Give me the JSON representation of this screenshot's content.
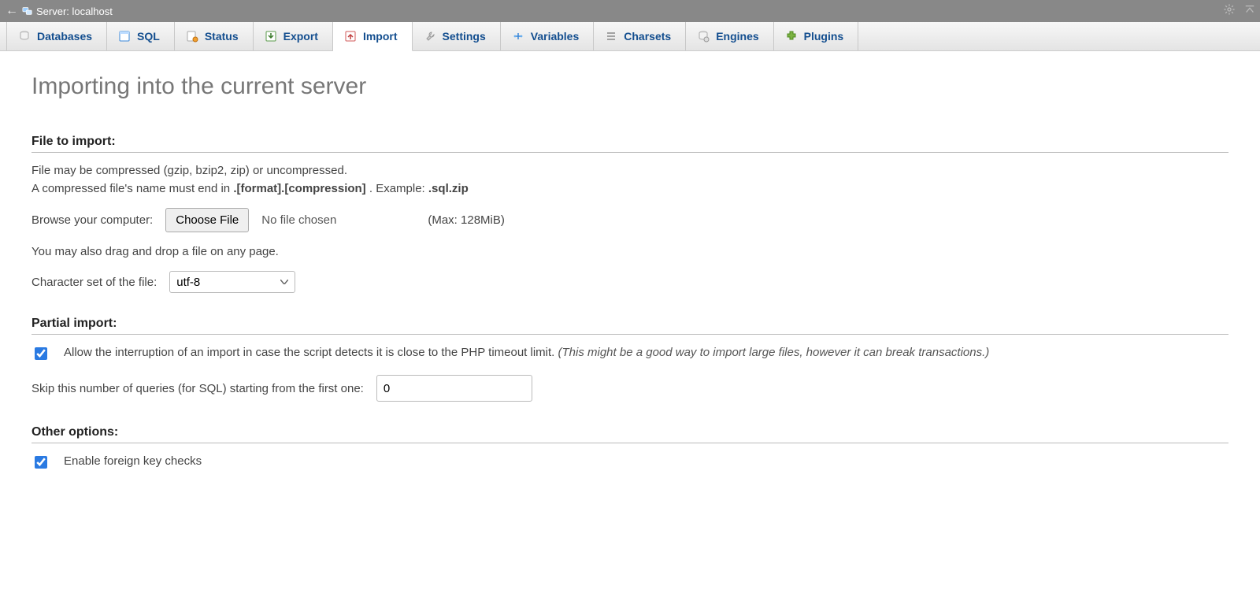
{
  "topbar": {
    "title": "Server: localhost"
  },
  "tabs": [
    {
      "label": "Databases",
      "active": false
    },
    {
      "label": "SQL",
      "active": false
    },
    {
      "label": "Status",
      "active": false
    },
    {
      "label": "Export",
      "active": false
    },
    {
      "label": "Import",
      "active": true
    },
    {
      "label": "Settings",
      "active": false
    },
    {
      "label": "Variables",
      "active": false
    },
    {
      "label": "Charsets",
      "active": false
    },
    {
      "label": "Engines",
      "active": false
    },
    {
      "label": "Plugins",
      "active": false
    }
  ],
  "page": {
    "title": "Importing into the current server"
  },
  "file_section": {
    "heading": "File to import:",
    "line1": "File may be compressed (gzip, bzip2, zip) or uncompressed.",
    "line2_prefix": "A compressed file's name must end in ",
    "line2_bold1": ".[format].[compression]",
    "line2_mid": ". Example: ",
    "line2_bold2": ".sql.zip",
    "browse_label": "Browse your computer:",
    "choose_button": "Choose File",
    "no_file": "No file chosen",
    "max_note": "(Max: 128MiB)",
    "dragdrop_hint": "You may also drag and drop a file on any page.",
    "charset_label": "Character set of the file:",
    "charset_value": "utf-8"
  },
  "partial_section": {
    "heading": "Partial import:",
    "allow_interrupt_checked": true,
    "allow_interrupt_text": "Allow the interruption of an import in case the script detects it is close to the PHP timeout limit. ",
    "allow_interrupt_hint": "(This might be a good way to import large files, however it can break transactions.)",
    "skip_label": "Skip this number of queries (for SQL) starting from the first one:",
    "skip_value": "0"
  },
  "other_section": {
    "heading": "Other options:",
    "fk_checked": true,
    "fk_label": "Enable foreign key checks"
  }
}
